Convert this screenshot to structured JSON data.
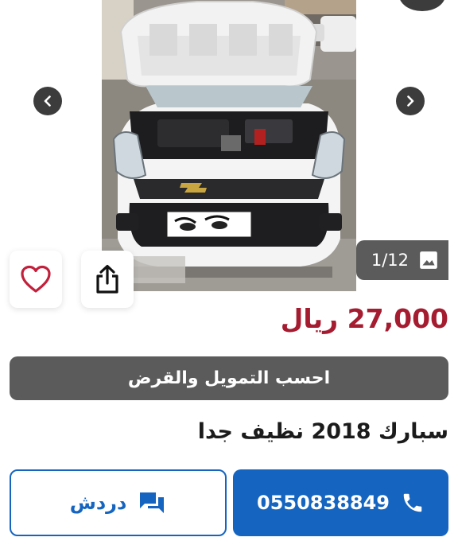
{
  "gallery": {
    "counter": "1/12"
  },
  "listing": {
    "price_amount": "27,000",
    "currency": "ريال",
    "title": "سبارك 2018 نظيف جدا"
  },
  "finance": {
    "label": "احسب التمويل والقرض"
  },
  "actions": {
    "phone_number": "0550838849",
    "chat_label": "دردش"
  },
  "colors": {
    "price": "#a51c30",
    "primary": "#1565c0",
    "gray_button": "#5b5b5b"
  },
  "icons": [
    "chevron-left-icon",
    "chevron-right-icon",
    "gallery-icon",
    "heart-icon",
    "share-icon",
    "phone-icon",
    "chat-icon"
  ]
}
